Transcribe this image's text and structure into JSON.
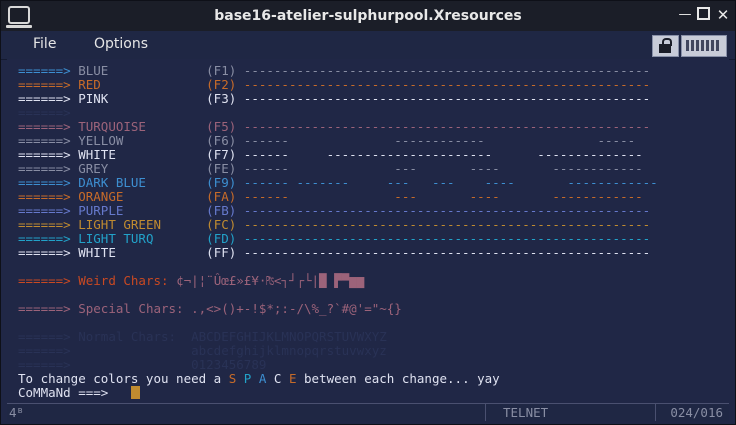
{
  "window": {
    "title": "base16-atelier-sulphurpool.Xresources"
  },
  "menu": {
    "file": "File",
    "options": "Options"
  },
  "colors": {
    "background": "#202746",
    "arrow": "#3d8fd1",
    "fg": "#dfe2f1",
    "dim": "#898ea4",
    "red": "#c94922",
    "orange": "#c76b29",
    "yellow": "#c08b30",
    "cyan": "#22a2c9",
    "blue": "#3d8fd1",
    "magenta": "#9c637a",
    "purple": "#6679cc",
    "invisible": "#293256"
  },
  "terminal": {
    "lines": [
      {
        "segs": [
          {
            "t": "======> ",
            "c": "arrow"
          },
          {
            "t": "BLUE",
            "c": "dim"
          },
          {
            "t": "             (F1) ",
            "c": "dim"
          },
          {
            "t": "------------------------------------------------------",
            "c": "dim"
          }
        ]
      },
      {
        "segs": [
          {
            "t": "======> ",
            "c": "orange"
          },
          {
            "t": "RED",
            "c": "orange"
          },
          {
            "t": "              (F2) ",
            "c": "orange"
          },
          {
            "t": "------------------------------------------------------",
            "c": "orange"
          }
        ]
      },
      {
        "segs": [
          {
            "t": "======> ",
            "c": "fg"
          },
          {
            "t": "PINK",
            "c": "fg"
          },
          {
            "t": "             (F3) ",
            "c": "fg"
          },
          {
            "t": "------------------------------------------------------",
            "c": "fg"
          }
        ]
      },
      {
        "segs": [
          {
            "t": "======> ",
            "c": "invisible"
          },
          {
            "t": "",
            "c": "invisible"
          }
        ]
      },
      {
        "segs": [
          {
            "t": "======> ",
            "c": "magenta"
          },
          {
            "t": "TURQUOISE",
            "c": "magenta"
          },
          {
            "t": "        (F5) ",
            "c": "magenta"
          },
          {
            "t": "------------------------------------------------------",
            "c": "magenta"
          }
        ]
      },
      {
        "segs": [
          {
            "t": "======> ",
            "c": "dim"
          },
          {
            "t": "YELLOW",
            "c": "dim"
          },
          {
            "t": "           (F6) ",
            "c": "dim"
          },
          {
            "t": "------              ------------               -----",
            "c": "dim"
          }
        ]
      },
      {
        "segs": [
          {
            "t": "======> ",
            "c": "fg"
          },
          {
            "t": "WHITE",
            "c": "fg"
          },
          {
            "t": "            (F7) ",
            "c": "fg"
          },
          {
            "t": "------     ----------------------      --------------",
            "c": "fg"
          }
        ]
      },
      {
        "segs": [
          {
            "t": "======> ",
            "c": "dim"
          },
          {
            "t": "GREY",
            "c": "dim"
          },
          {
            "t": "             (FE) ",
            "c": "dim"
          },
          {
            "t": "------              ---       ----       ------------",
            "c": "dim"
          }
        ]
      },
      {
        "segs": [
          {
            "t": "======> ",
            "c": "blue"
          },
          {
            "t": "DARK BLUE",
            "c": "blue"
          },
          {
            "t": "        (F9) ",
            "c": "blue"
          },
          {
            "t": "------ -------     ---   ---    ----       ------------",
            "c": "blue"
          }
        ]
      },
      {
        "segs": [
          {
            "t": "======> ",
            "c": "orange"
          },
          {
            "t": "ORANGE",
            "c": "orange"
          },
          {
            "t": "           (FA) ",
            "c": "orange"
          },
          {
            "t": "------              ---       ----       ------------",
            "c": "orange"
          }
        ]
      },
      {
        "segs": [
          {
            "t": "======> ",
            "c": "purple"
          },
          {
            "t": "PURPLE",
            "c": "purple"
          },
          {
            "t": "           (FB) ",
            "c": "purple"
          },
          {
            "t": "------------------------------------------------------",
            "c": "purple"
          }
        ]
      },
      {
        "segs": [
          {
            "t": "======> ",
            "c": "yellow"
          },
          {
            "t": "LIGHT GREEN",
            "c": "yellow"
          },
          {
            "t": "      (FC) ",
            "c": "yellow"
          },
          {
            "t": "------------------------------------------------------",
            "c": "yellow"
          }
        ]
      },
      {
        "segs": [
          {
            "t": "======> ",
            "c": "cyan"
          },
          {
            "t": "LIGHT TURQ",
            "c": "cyan"
          },
          {
            "t": "       (FD) ",
            "c": "cyan"
          },
          {
            "t": "------------------------------------------------------",
            "c": "cyan"
          }
        ]
      },
      {
        "segs": [
          {
            "t": "======> ",
            "c": "fg"
          },
          {
            "t": "WHITE",
            "c": "fg"
          },
          {
            "t": "            (FF) ",
            "c": "fg"
          },
          {
            "t": "------------------------------------------------------",
            "c": "fg"
          }
        ]
      },
      {
        "segs": [
          {
            "t": "",
            "c": "fg"
          }
        ]
      },
      {
        "segs": [
          {
            "t": "======> ",
            "c": "red"
          },
          {
            "t": "Weird Chars: ",
            "c": "red"
          },
          {
            "t": "¢¬|¦¨Ûœ£»£¥·₧<┐┘┌└|█ ▛▀▆▆",
            "c": "magenta"
          }
        ]
      },
      {
        "segs": [
          {
            "t": "",
            "c": "fg"
          }
        ]
      },
      {
        "segs": [
          {
            "t": "======> ",
            "c": "magenta"
          },
          {
            "t": "Special Chars: ",
            "c": "magenta"
          },
          {
            "t": ".,<>()+-!$*;:-/\\%_?`#@'=\"~{}",
            "c": "magenta"
          }
        ]
      },
      {
        "segs": [
          {
            "t": "",
            "c": "fg"
          }
        ]
      },
      {
        "segs": [
          {
            "t": "======> ",
            "c": "invisible"
          },
          {
            "t": "Normal Chars:  ",
            "c": "invisible"
          },
          {
            "t": "ABCDEFGHIJKLMNOPQRSTUVWXYZ",
            "c": "invisible"
          }
        ]
      },
      {
        "segs": [
          {
            "t": "======> ",
            "c": "invisible"
          },
          {
            "t": "               ",
            "c": "invisible"
          },
          {
            "t": "abcdefghijklmnopqrstuvwxyz",
            "c": "invisible"
          }
        ]
      },
      {
        "segs": [
          {
            "t": "======> ",
            "c": "invisible"
          },
          {
            "t": "               ",
            "c": "invisible"
          },
          {
            "t": "0123456789",
            "c": "invisible"
          }
        ]
      },
      {
        "segs": [
          {
            "t": "To change colors you need a ",
            "c": "fg"
          },
          {
            "t": "S",
            "c": "orange"
          },
          {
            "t": " ",
            "c": "fg"
          },
          {
            "t": "P",
            "c": "cyan"
          },
          {
            "t": " ",
            "c": "fg"
          },
          {
            "t": "A",
            "c": "blue"
          },
          {
            "t": " ",
            "c": "fg"
          },
          {
            "t": "C",
            "c": "fg"
          },
          {
            "t": " ",
            "c": "fg"
          },
          {
            "t": "E",
            "c": "orange"
          },
          {
            "t": " between each change... yay",
            "c": "fg"
          }
        ]
      },
      {
        "segs": [
          {
            "t": "CoMMaNd ===> ",
            "c": "fg"
          },
          {
            "t": "  ",
            "c": "fg"
          }
        ],
        "cursor": true
      }
    ]
  },
  "status": {
    "left": "4ᴮ",
    "center": "TELNET",
    "right": "024/016"
  }
}
